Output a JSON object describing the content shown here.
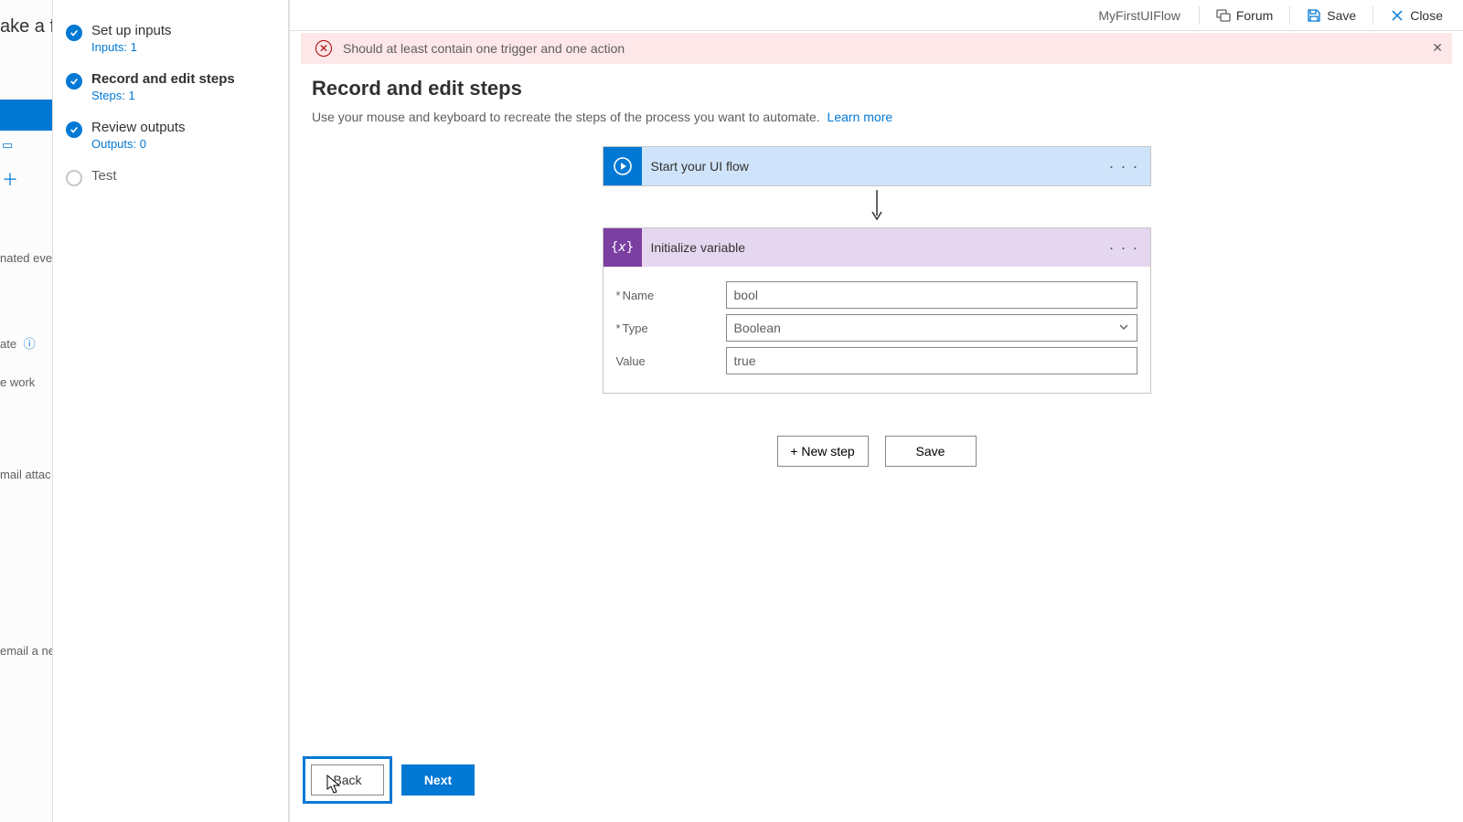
{
  "bg_fragments": {
    "title": "ake a flo",
    "nated": "nated even",
    "date": "ate",
    "work": "e work",
    "attach": "mail attac",
    "email_new": "email a ne"
  },
  "steps": [
    {
      "title": "Set up inputs",
      "sub": "Inputs: 1",
      "state": "done"
    },
    {
      "title": "Record and edit steps",
      "sub": "Steps: 1",
      "state": "done",
      "bold": true
    },
    {
      "title": "Review outputs",
      "sub": "Outputs: 0",
      "state": "done"
    },
    {
      "title": "Test",
      "sub": "",
      "state": "empty"
    }
  ],
  "topbar": {
    "flow_name": "MyFirstUIFlow",
    "forum": "Forum",
    "save": "Save",
    "close": "Close"
  },
  "banner": {
    "text": "Should at least contain one trigger and one action"
  },
  "page": {
    "heading": "Record and edit steps",
    "desc": "Use your mouse and keyboard to recreate the steps of the process you want to automate.",
    "learn_more": "Learn more"
  },
  "actions": {
    "start_label": "Start your UI flow",
    "var_label": "Initialize variable",
    "fields": {
      "name_label": "Name",
      "name_value": "bool",
      "type_label": "Type",
      "type_value": "Boolean",
      "value_label": "Value",
      "value_value": "true"
    }
  },
  "buttons": {
    "new_step": "+ New step",
    "save": "Save",
    "back": "Back",
    "next": "Next"
  }
}
